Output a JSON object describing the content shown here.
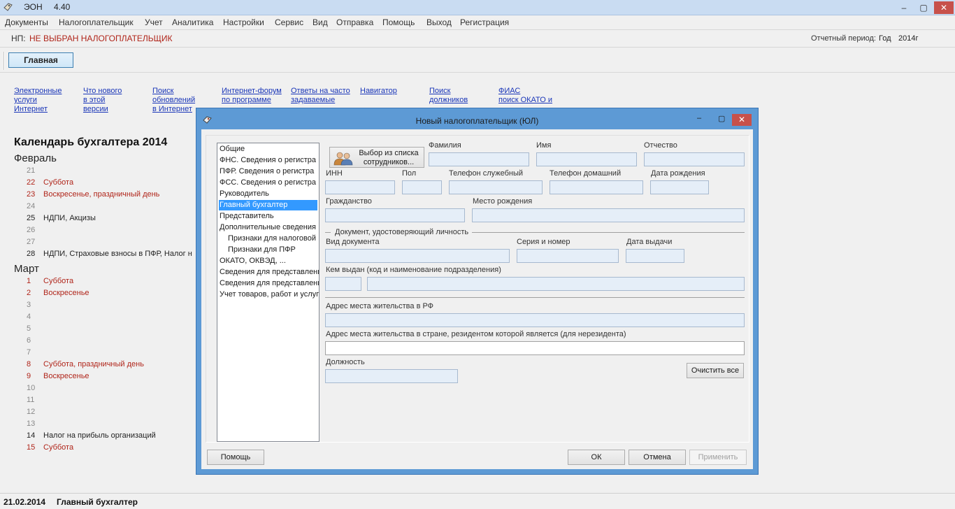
{
  "app": {
    "name": "ЭОН",
    "version": "4.40",
    "window_controls": {
      "minimize": "–",
      "restore": "▢",
      "close": "✕"
    }
  },
  "menu": [
    "Документы",
    "Налогоплательщик",
    "Учет",
    "Аналитика",
    "Настройки",
    "Сервис",
    "Вид",
    "Отправка",
    "Помощь",
    "Выход",
    "Регистрация"
  ],
  "taxpayer_bar": {
    "label": "НП:",
    "value": "НЕ ВЫБРАН НАЛОГОПЛАТЕЛЬЩИК",
    "period_label": "Отчетный период:",
    "period_kind": "Год",
    "period_year": "2014г"
  },
  "toolbar": {
    "main_button": "Главная"
  },
  "links": [
    {
      "lines": [
        "Электронные",
        "услуги",
        "Интернет"
      ]
    },
    {
      "lines": [
        "Что нового",
        "в этой",
        "версии"
      ]
    },
    {
      "lines": [
        "Поиск",
        "обновлений",
        "в Интернет"
      ]
    },
    {
      "lines": [
        "Интернет-форум",
        "по программе"
      ]
    },
    {
      "lines": [
        "Ответы на часто",
        "задаваемые"
      ]
    },
    {
      "lines": [
        "Навигатор"
      ]
    },
    {
      "lines": [
        "Поиск",
        "должников"
      ]
    },
    {
      "lines": [
        "ФИАС",
        "поиск ОКАТО и"
      ]
    }
  ],
  "calendar": {
    "title": "Календарь бухгалтера 2014",
    "months": [
      {
        "name": "Февраль",
        "days": [
          {
            "day": "21",
            "text": "",
            "style": "grey"
          },
          {
            "day": "22",
            "text": "Суббота",
            "style": "red"
          },
          {
            "day": "23",
            "text": "Воскресенье, праздничный день",
            "style": "red"
          },
          {
            "day": "24",
            "text": "",
            "style": "grey"
          },
          {
            "day": "25",
            "text": "НДПИ, Акцизы",
            "style": "norm"
          },
          {
            "day": "26",
            "text": "",
            "style": "grey"
          },
          {
            "day": "27",
            "text": "",
            "style": "grey"
          },
          {
            "day": "28",
            "text": "НДПИ, Страховые взносы в ПФР, Налог н",
            "style": "norm"
          }
        ]
      },
      {
        "name": "Март",
        "days": [
          {
            "day": "1",
            "text": "Суббота",
            "style": "red"
          },
          {
            "day": "2",
            "text": "Воскресенье",
            "style": "red"
          },
          {
            "day": "3",
            "text": "",
            "style": "grey"
          },
          {
            "day": "4",
            "text": "",
            "style": "grey"
          },
          {
            "day": "5",
            "text": "",
            "style": "grey"
          },
          {
            "day": "6",
            "text": "",
            "style": "grey"
          },
          {
            "day": "7",
            "text": "",
            "style": "grey"
          },
          {
            "day": "8",
            "text": "Суббота, праздничный день",
            "style": "red"
          },
          {
            "day": "9",
            "text": "Воскресенье",
            "style": "red"
          },
          {
            "day": "10",
            "text": "",
            "style": "grey"
          },
          {
            "day": "11",
            "text": "",
            "style": "grey"
          },
          {
            "day": "12",
            "text": "",
            "style": "grey"
          },
          {
            "day": "13",
            "text": "",
            "style": "grey"
          },
          {
            "day": "14",
            "text": "Налог на прибыль организаций",
            "style": "norm"
          },
          {
            "day": "15",
            "text": "Суббота",
            "style": "red"
          }
        ]
      }
    ]
  },
  "statusbar": {
    "date": "21.02.2014",
    "role": "Главный бухгалтер"
  },
  "dialog": {
    "title": "Новый налогоплательщик (ЮЛ)",
    "tree": [
      {
        "label": "Общие",
        "level": 0,
        "selected": false
      },
      {
        "label": "ФНС. Сведения о регистра",
        "level": 0,
        "selected": false
      },
      {
        "label": "ПФР. Сведения о регистра",
        "level": 0,
        "selected": false
      },
      {
        "label": "ФСС. Сведения о регистра",
        "level": 0,
        "selected": false
      },
      {
        "label": "Руководитель",
        "level": 0,
        "selected": false
      },
      {
        "label": "Главный бухгалтер",
        "level": 0,
        "selected": true
      },
      {
        "label": "Представитель",
        "level": 0,
        "selected": false
      },
      {
        "label": "Дополнительные сведения",
        "level": 0,
        "selected": false
      },
      {
        "label": "Признаки для налоговой",
        "level": 1,
        "selected": false
      },
      {
        "label": "Признаки для ПФР",
        "level": 1,
        "selected": false
      },
      {
        "label": "ОКАТО, ОКВЭД, ...",
        "level": 0,
        "selected": false
      },
      {
        "label": "Сведения для представлени",
        "level": 0,
        "selected": false
      },
      {
        "label": "Сведения для представлени",
        "level": 0,
        "selected": false
      },
      {
        "label": "Учет товаров, работ и услуг",
        "level": 0,
        "selected": false
      }
    ],
    "select_employee_lines": [
      "Выбор из списка",
      "сотрудников..."
    ],
    "labels": {
      "surname": "Фамилия",
      "name": "Имя",
      "patronymic": "Отчество",
      "inn": "ИНН",
      "sex": "Пол",
      "phone_work": "Телефон служебный",
      "phone_home": "Телефон домашний",
      "birth_date": "Дата рождения",
      "citizenship": "Гражданство",
      "birth_place": "Место рождения",
      "id_group": "Документ, удостоверяющий личность",
      "doc_type": "Вид документа",
      "series_number": "Серия и номер",
      "issue_date": "Дата выдачи",
      "issued_by": "Кем выдан (код и наименование подразделения)",
      "address_rf": "Адрес места жительства в РФ",
      "address_foreign": "Адрес места жительства в стране, резидентом которой является (для нерезидента)",
      "position": "Должность"
    },
    "values": {
      "surname": "",
      "name": "",
      "patronymic": "",
      "inn": "",
      "sex": "",
      "phone_work": "",
      "phone_home": "",
      "birth_date": "",
      "citizenship": "",
      "birth_place": "",
      "doc_type": "",
      "series_number": "",
      "issue_date": "",
      "issued_by_code": "",
      "issued_by_name": "",
      "address_rf": "",
      "address_foreign": "",
      "position": ""
    },
    "buttons": {
      "clear_all": "Очистить все",
      "help": "Помощь",
      "ok": "ОК",
      "cancel": "Отмена",
      "apply": "Применить"
    }
  }
}
